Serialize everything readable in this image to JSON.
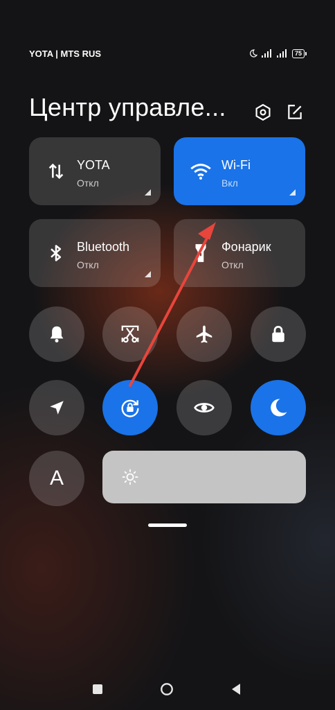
{
  "status_bar": {
    "carriers": "YOTA | MTS RUS",
    "battery": "75",
    "icons": [
      "moon-icon",
      "signal-icon",
      "signal-icon"
    ]
  },
  "header": {
    "title": "Центр управле...",
    "icons": [
      "settings-icon",
      "edit-icon"
    ]
  },
  "tiles": [
    {
      "label": "YOTA",
      "state": "Откл",
      "icon": "mobile-data-icon",
      "active": false
    },
    {
      "label": "Wi-Fi",
      "state": "Вкл",
      "icon": "wifi-icon",
      "active": true
    },
    {
      "label": "Bluetooth",
      "state": "Откл",
      "icon": "bluetooth-icon",
      "active": false
    },
    {
      "label": "Фонарик",
      "state": "Откл",
      "icon": "flashlight-icon",
      "active": false
    }
  ],
  "toggles_row1": [
    {
      "icon": "bell-icon",
      "active": false
    },
    {
      "icon": "screenshot-icon",
      "active": false
    },
    {
      "icon": "airplane-icon",
      "active": false
    },
    {
      "icon": "lock-icon",
      "active": false
    }
  ],
  "toggles_row2": [
    {
      "icon": "location-icon",
      "active": false
    },
    {
      "icon": "rotation-lock-icon",
      "active": true
    },
    {
      "icon": "eye-icon",
      "active": false
    },
    {
      "icon": "moon-icon",
      "active": true
    }
  ],
  "auto_brightness": {
    "label": "A",
    "icon": "auto-brightness-icon"
  },
  "brightness": {
    "icon": "sun-icon"
  },
  "annotation": {
    "color": "#e8453c"
  },
  "colors": {
    "accent": "#1a73e8"
  },
  "nav_bar": {
    "icons": [
      "recents-icon",
      "home-icon",
      "back-icon"
    ]
  }
}
